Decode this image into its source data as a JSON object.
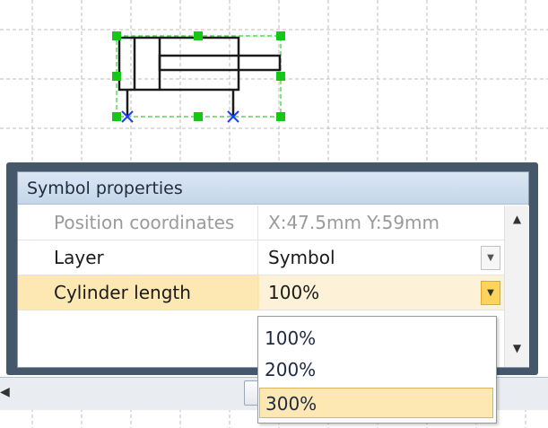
{
  "panel": {
    "title": "Symbol properties",
    "rows": [
      {
        "name": "Position coordinates",
        "value": "X:47.5mm Y:59mm",
        "state": "disabled"
      },
      {
        "name": "Layer",
        "value": "Symbol",
        "state": "normal"
      },
      {
        "name": "Cylinder length",
        "value": "100%",
        "state": "selected"
      }
    ]
  },
  "dropdown": {
    "options": [
      "100%",
      "200%",
      "300%"
    ],
    "highlighted": "300%"
  },
  "icons": {
    "dropdown": "chevron-down-icon",
    "scroll_up": "up-arrow-icon",
    "scroll_down": "down-arrow-icon",
    "scroll_left": "left-arrow-icon"
  },
  "colors": {
    "selection_handle": "#18c618",
    "connection_point": "#1a3cff",
    "selected_row": "#fde7b2",
    "panel_frame": "#44576b"
  }
}
